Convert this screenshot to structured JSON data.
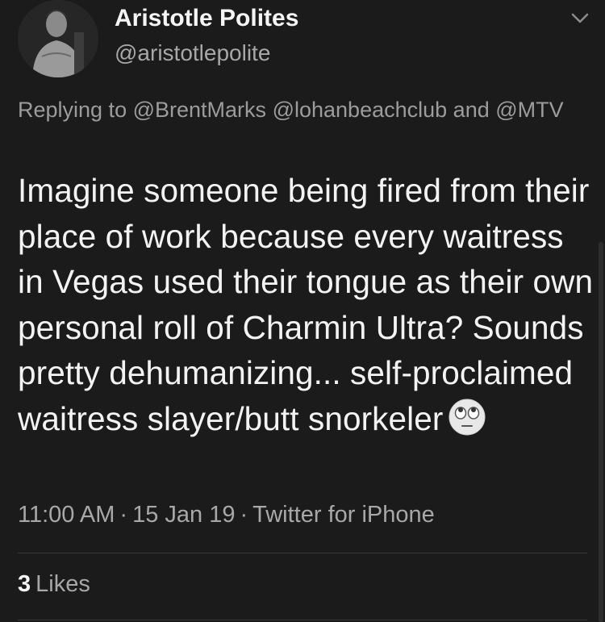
{
  "tweet": {
    "display_name": "Aristotle Polites",
    "handle": "@aristotlepolite",
    "replying_prefix": "Replying to",
    "reply_users": [
      "@BrentMarks",
      "@lohanbeachclub"
    ],
    "reply_and": "and",
    "reply_last": "@MTV",
    "text": "Imagine someone being fired from their place of work because every waitress in Vegas used their tongue as their own personal roll of Charmin Ultra? Sounds pretty dehumanizing... self-proclaimed waitress slayer/butt snorkeler",
    "emoji": "face-with-rolling-eyes-icon",
    "time": "11:00 AM",
    "date": "15 Jan 19",
    "source": "Twitter for iPhone",
    "separator": "·",
    "likes_count": "3",
    "likes_label": "Likes"
  },
  "colors": {
    "background": "#1b1b1b",
    "primary_text": "#f3f3f3",
    "secondary_text": "#a8a8a8",
    "divider": "#383838"
  }
}
